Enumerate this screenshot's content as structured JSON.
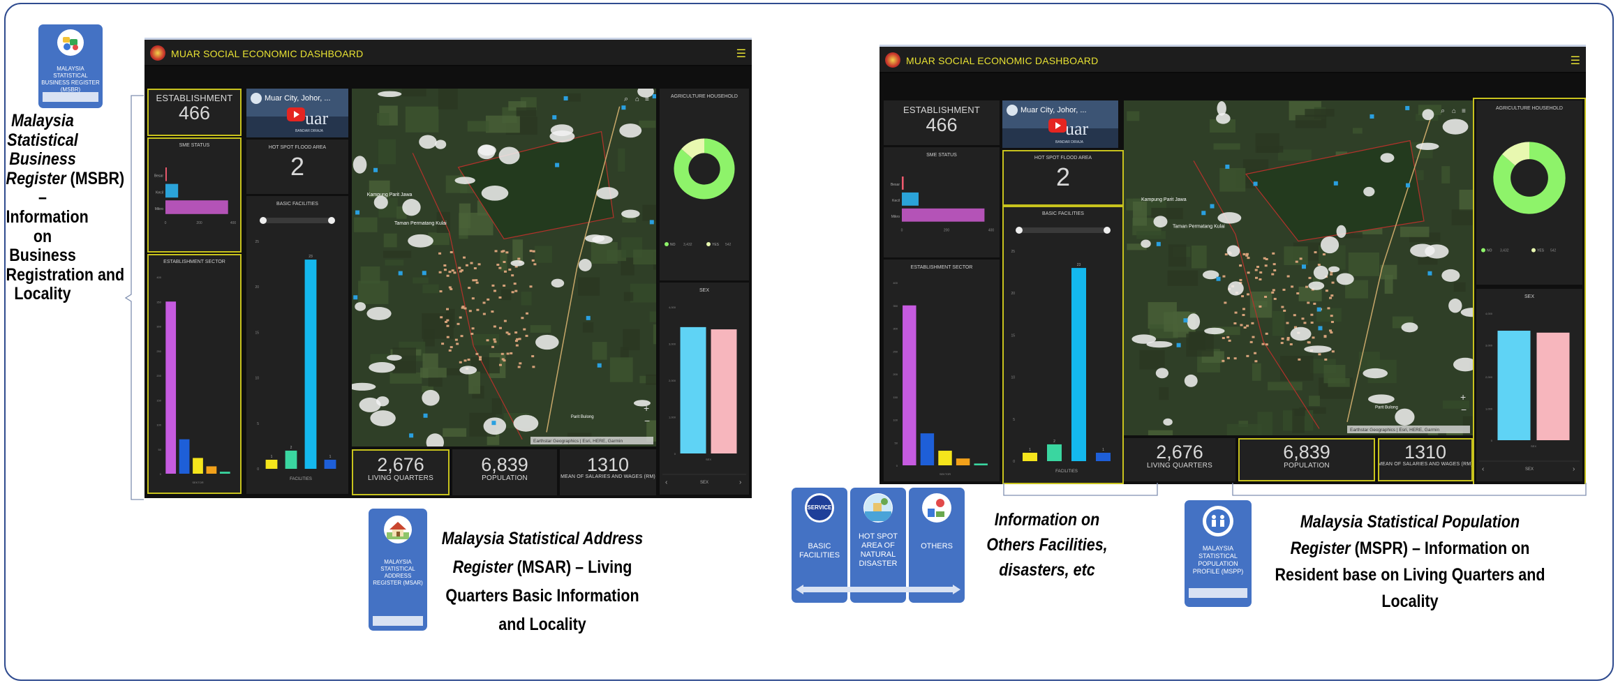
{
  "left_caption": {
    "lines_italic": [
      "Malaysia",
      "Statistical",
      "Business",
      "Register"
    ],
    "abbr": " (MSBR)",
    "lines_plain": [
      "– Information",
      "on Business",
      "Registration and",
      "Locality"
    ]
  },
  "badges": {
    "msbr": "MALAYSIA STATISTICAL BUSINESS REGISTER (MSBR)",
    "msar": "MALAYSIA STATISTICAL ADDRESS REGISTER (MSAR)",
    "basic": "BASIC FACILITIES",
    "hotspot": "HOT SPOT AREA OF NATURAL DISASTER",
    "others": "OTHERS",
    "mspp": "MALAYSIA STATISTICAL POPULATION PROFILE (MSPP)",
    "service_icon_text": "SERVICE"
  },
  "captions": {
    "msar": {
      "line1_italic": "Malaysia Statistical Address",
      "line2_italic": "Register",
      "line2_plain": " (MSAR) – Living",
      "line3": "Quarters Basic Information",
      "line4": "and Locality"
    },
    "others": {
      "line1": "Information on",
      "line2": "Others Facilities,",
      "line3": "disasters, etc"
    },
    "mspr": {
      "line1_italic": "Malaysia Statistical Population",
      "line2_italic": "Register",
      "line2_plain": " (MSPR) – Information on",
      "line3": "Resident base on Living Quarters and",
      "line4": "Locality"
    }
  },
  "dashboard": {
    "title": "MUAR SOCIAL ECONOMIC DASHBOARD",
    "menu_icon": "hamburger-icon",
    "establishment": {
      "label": "ESTABLISHMENT",
      "value": "466"
    },
    "sme_status": {
      "title": "SME STATUS",
      "categories": [
        "Besar",
        "Kecil",
        "Mikro"
      ],
      "values": [
        8,
        75,
        370
      ],
      "ticks": [
        "0",
        "200",
        "400"
      ],
      "colors": [
        "#f05a6e",
        "#2ba3d9",
        "#b453b7"
      ]
    },
    "establishment_sector": {
      "title": "ESTABLISHMENT SECTOR",
      "values": [
        350,
        70,
        32,
        15,
        4
      ],
      "colors": [
        "#c65be0",
        "#1e5fd8",
        "#f5e51c",
        "#f2a11a",
        "#3ad6a0"
      ],
      "ticks": [
        "0",
        "50",
        "100",
        "150",
        "200",
        "250",
        "300",
        "350",
        "400"
      ],
      "xlabel": "SEKTOR"
    },
    "video": {
      "title": "Muar City, Johor, ...",
      "overlay": "uar",
      "sub": "BANDAR DIRAJA"
    },
    "hot_spot": {
      "label": "HOT SPOT FLOOD AREA",
      "value": "2"
    },
    "basic_facilities": {
      "title": "BASIC FACILITIES",
      "values": [
        1,
        2,
        23,
        1
      ],
      "labels": [
        "1",
        "2",
        "23",
        "1"
      ],
      "colors": [
        "#f5e51c",
        "#3ad6a0",
        "#14b8ee",
        "#1e5fd8"
      ],
      "ticks": [
        "0",
        "5",
        "10",
        "15",
        "20",
        "25"
      ],
      "xlabel": "FACILITIES"
    },
    "map": {
      "attribution": "Earthstar Geographics | Esri, HERE, Garmin",
      "place1": "Kampung Parit Jawa",
      "place2": "Taman Permatang Kulai",
      "place3": "Parit Bulong"
    },
    "agri": {
      "title": "AGRICULTURE HOUSEHOLD",
      "values": [
        3432,
        542
      ],
      "colors": [
        "#8ef36a",
        "#e8f8b0"
      ],
      "legend": [
        {
          "name": "NO",
          "value": "3,432"
        },
        {
          "name": "YES",
          "value": "542"
        }
      ]
    },
    "sex": {
      "title": "SEX",
      "values": [
        3450,
        3389
      ],
      "colors": [
        "#5fd3f5",
        "#f7b6bd"
      ],
      "xlabel": "SEX",
      "ticks": [
        "0",
        "1,000",
        "2,000",
        "3,000",
        "4,000"
      ],
      "footer": "SEX"
    },
    "living_quarters": {
      "value": "2,676",
      "label": "LIVING QUARTERS"
    },
    "population": {
      "value": "6,839",
      "label": "POPULATION"
    },
    "salary": {
      "value": "1310",
      "label": "MEAN OF SALARIES AND WAGES (RM)"
    }
  }
}
